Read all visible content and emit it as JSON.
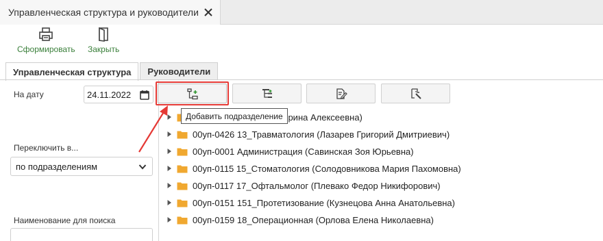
{
  "window_tab": {
    "title": "Управленческая структура и руководители"
  },
  "toolbar": {
    "form_label": "Сформировать",
    "close_label": "Закрыть"
  },
  "inner_tabs": [
    {
      "label": "Управленческая структура",
      "active": true
    },
    {
      "label": "Руководители",
      "active": false
    }
  ],
  "left_panel": {
    "date_label": "На дату",
    "date_value": "24.11.2022",
    "switch_label": "Переключить в...",
    "switch_value": "по подразделениям",
    "search_label": "Наименование для поиска",
    "search_value": ""
  },
  "actions": {
    "add_tooltip": "Добавить подразделение"
  },
  "tree": {
    "items": [
      {
        "label": "пия (Елизарьева Екатерина Алексеевна)"
      },
      {
        "label": "00уп-0426 13_Травматология (Лазарев Григорий Дмитриевич)"
      },
      {
        "label": "00уп-0001 Администрация (Савинская Зоя Юрьевна)"
      },
      {
        "label": "00уп-0115 15_Стоматология (Солодовникова Мария Пахомовна)"
      },
      {
        "label": "00уп-0117 17_Офтальмолог (Плевако Федор Никифорович)"
      },
      {
        "label": "00уп-0151 151_Протетизование (Кузнецова Анна Анатольевна)"
      },
      {
        "label": "00уп-0159 18_Операционная (Орлова Елена Николаевна)"
      }
    ]
  },
  "colors": {
    "accent_green": "#3a7f3a",
    "folder": "#f0a830",
    "highlight_red": "#e53935"
  }
}
